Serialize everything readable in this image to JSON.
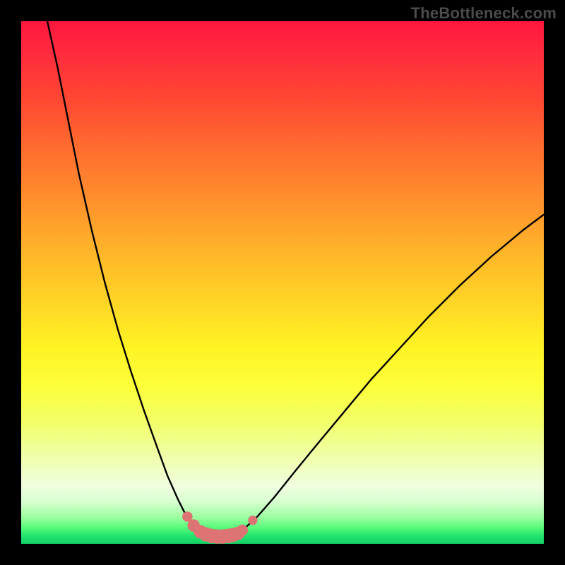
{
  "watermark": "TheBottleneck.com",
  "colors": {
    "frame": "#000000",
    "curve": "#000000",
    "marker_fill": "#dd7373",
    "marker_stroke": "#d86a6a"
  },
  "chart_data": {
    "type": "line",
    "title": "",
    "xlabel": "",
    "ylabel": "",
    "xlim": [
      0,
      100
    ],
    "ylim": [
      0,
      100
    ],
    "grid": false,
    "note": "Axes are unlabeled in the source image; x is an implicit horizontal parameter, y is bottleneck percentage (0 at bottom / green, 100 at top / red). Values are estimated from pixel positions.",
    "series": [
      {
        "name": "left-branch",
        "x": [
          5.0,
          7.0,
          9.0,
          11.0,
          13.5,
          16.0,
          18.5,
          21.0,
          23.5,
          26.0,
          28.0,
          30.0,
          31.5,
          33.0,
          34.2,
          35.0
        ],
        "y": [
          100.0,
          91.0,
          81.0,
          71.0,
          60.0,
          50.0,
          41.0,
          33.0,
          25.5,
          18.5,
          13.0,
          8.5,
          5.5,
          3.5,
          2.2,
          1.7
        ]
      },
      {
        "name": "valley-floor",
        "x": [
          35.0,
          36.0,
          37.0,
          38.0,
          39.0,
          40.0,
          41.0,
          42.0
        ],
        "y": [
          1.7,
          1.5,
          1.4,
          1.4,
          1.4,
          1.5,
          1.7,
          2.3
        ]
      },
      {
        "name": "right-branch",
        "x": [
          42.0,
          45.0,
          48.5,
          52.5,
          57.0,
          62.0,
          67.0,
          72.5,
          78.0,
          84.0,
          90.0,
          96.0,
          100.0
        ],
        "y": [
          2.3,
          5.0,
          9.0,
          14.0,
          19.5,
          25.5,
          31.5,
          37.5,
          43.5,
          49.5,
          55.0,
          60.0,
          63.0
        ]
      }
    ],
    "markers": {
      "name": "highlighted-points",
      "color": "#dd7373",
      "points": [
        {
          "x": 31.8,
          "y": 5.2,
          "r": 1.0
        },
        {
          "x": 33.0,
          "y": 3.5,
          "r": 1.2
        },
        {
          "x": 34.3,
          "y": 2.3,
          "r": 1.3
        },
        {
          "x": 35.4,
          "y": 1.8,
          "r": 1.4
        },
        {
          "x": 36.5,
          "y": 1.5,
          "r": 1.4
        },
        {
          "x": 37.5,
          "y": 1.4,
          "r": 1.4
        },
        {
          "x": 38.5,
          "y": 1.4,
          "r": 1.4
        },
        {
          "x": 39.5,
          "y": 1.5,
          "r": 1.4
        },
        {
          "x": 40.5,
          "y": 1.7,
          "r": 1.4
        },
        {
          "x": 41.5,
          "y": 2.0,
          "r": 1.3
        },
        {
          "x": 42.3,
          "y": 2.6,
          "r": 1.1
        },
        {
          "x": 44.3,
          "y": 4.5,
          "r": 0.9
        }
      ]
    }
  }
}
